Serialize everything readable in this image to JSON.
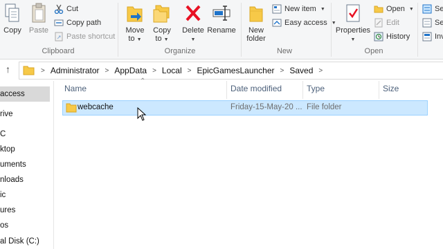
{
  "ribbon": {
    "clipboard": {
      "copy": "Copy",
      "paste": "Paste",
      "cut": "Cut",
      "copy_path": "Copy path",
      "paste_shortcut": "Paste shortcut",
      "label": "Clipboard"
    },
    "organize": {
      "move_to": [
        "Move",
        "to"
      ],
      "copy_to": [
        "Copy",
        "to"
      ],
      "delete": "Delete",
      "rename": "Rename",
      "label": "Organize"
    },
    "new": {
      "new_folder": [
        "New",
        "folder"
      ],
      "new_item": "New item",
      "easy_access": "Easy access",
      "label": "New"
    },
    "open": {
      "properties": "Properties",
      "open": "Open",
      "edit": "Edit",
      "history": "History",
      "label": "Open"
    },
    "select": {
      "select_all": "Sel",
      "select_none": "Sel",
      "invert": "Inv"
    }
  },
  "address": {
    "crumbs": [
      "Administrator",
      "AppData",
      "Local",
      "EpicGamesLauncher",
      "Saved"
    ]
  },
  "nav": {
    "items": [
      "access",
      "rive",
      "C",
      "ktop",
      "uments",
      "nloads",
      "ic",
      "ures",
      "os",
      "al Disk (C:)"
    ]
  },
  "columns": {
    "name": "Name",
    "date": "Date modified",
    "type": "Type",
    "size": "Size"
  },
  "rows": [
    {
      "name": "webcache",
      "date": "Friday-15-May-20 ...",
      "type": "File folder",
      "size": ""
    }
  ],
  "colors": {
    "folder": "#f7c948",
    "selection": "#cce8ff",
    "selection_border": "#99d1ff",
    "delete_red": "#e81123",
    "accent_blue": "#1e73c9"
  }
}
